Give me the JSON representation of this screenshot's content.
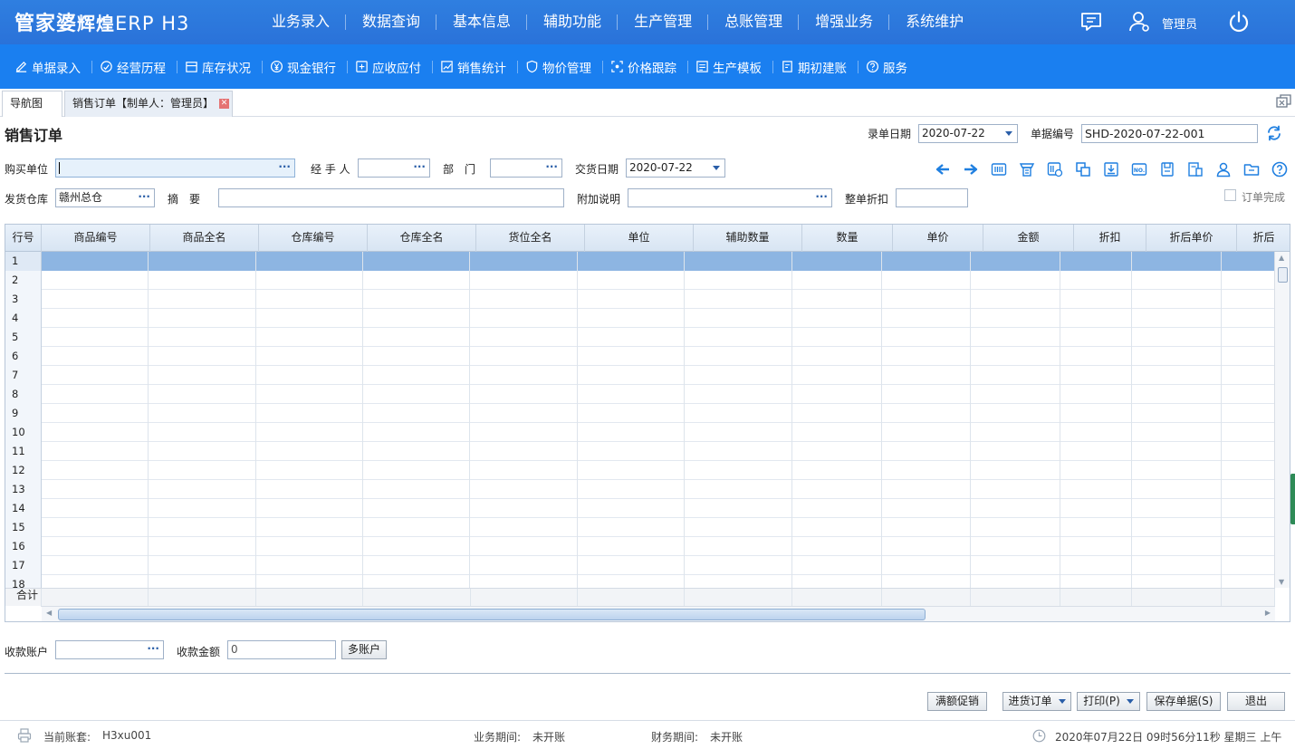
{
  "app": {
    "logo_main": "管家婆",
    "logo_sub": "辉煌",
    "logo_ver": "ERP H3"
  },
  "main_nav": [
    "业务录入",
    "数据查询",
    "基本信息",
    "辅助功能",
    "生产管理",
    "总账管理",
    "增强业务",
    "系统维护"
  ],
  "header_user": "管理员",
  "sub_nav": [
    {
      "label": "单据录入",
      "icon": "edit-icon"
    },
    {
      "label": "经营历程",
      "icon": "history-icon"
    },
    {
      "label": "库存状况",
      "icon": "warehouse-icon"
    },
    {
      "label": "现金银行",
      "icon": "yen-icon"
    },
    {
      "label": "应收应付",
      "icon": "ledger-icon"
    },
    {
      "label": "销售统计",
      "icon": "stats-icon"
    },
    {
      "label": "物价管理",
      "icon": "shield-icon"
    },
    {
      "label": "价格跟踪",
      "icon": "track-icon"
    },
    {
      "label": "生产模板",
      "icon": "template-icon"
    },
    {
      "label": "期初建账",
      "icon": "account-icon"
    },
    {
      "label": "服务",
      "icon": "help-icon"
    }
  ],
  "tabs": {
    "nav": "导航图",
    "active": "销售订单【制单人：管理员】"
  },
  "form": {
    "title": "销售订单",
    "entry_date_label": "录单日期",
    "entry_date": "2020-07-22",
    "doc_no_label": "单据编号",
    "doc_no": "SHD-2020-07-22-001",
    "buyer_label": "购买单位",
    "buyer": "",
    "handler_label": "经 手 人",
    "handler": "",
    "dept_label": "部　门",
    "dept": "",
    "delivery_date_label": "交货日期",
    "delivery_date": "2020-07-22",
    "warehouse_label": "发货仓库",
    "warehouse": "赣州总仓",
    "summary_label": "摘　要",
    "summary": "",
    "extra_label": "附加说明",
    "extra": "",
    "discount_label": "整单折扣",
    "discount": "",
    "order_done_label": "订单完成"
  },
  "toolbar_icons": [
    "arrow-left-icon",
    "arrow-right-icon",
    "barcode-icon",
    "print-template-icon",
    "scan-icon",
    "copy-icon",
    "import-icon",
    "number-icon",
    "save-icon",
    "stats-doc-icon",
    "person-icon",
    "folder-icon",
    "help-circle-icon"
  ],
  "grid": {
    "columns": [
      "行号",
      "商品编号",
      "商品全名",
      "仓库编号",
      "仓库全名",
      "货位全名",
      "单位",
      "辅助数量",
      "数量",
      "单价",
      "金额",
      "折扣",
      "折后单价",
      "折后"
    ],
    "rows": [
      "1",
      "2",
      "3",
      "4",
      "5",
      "6",
      "7",
      "8",
      "9",
      "10",
      "11",
      "12",
      "13",
      "14",
      "15",
      "16",
      "17",
      "18"
    ],
    "total_label": "合计"
  },
  "payment": {
    "account_label": "收款账户",
    "account": "",
    "amount_label": "收款金额",
    "amount": "0",
    "multi_button": "多账户"
  },
  "buttons": {
    "promo": "满额促销",
    "purchase_order": "进货订单",
    "print": "打印(P)",
    "save": "保存单据(S)",
    "exit": "退出"
  },
  "status": {
    "account_label": "当前账套:",
    "account": "H3xu001",
    "biz_period_label": "业务期间:",
    "biz_period": "未开账",
    "fin_period_label": "财务期间:",
    "fin_period": "未开账",
    "datetime": "2020年07月22日 09时56分11秒 星期三 上午"
  },
  "colors": {
    "topbar": "#2a72d9",
    "subbar": "#1a7ff0",
    "row_selected": "#8db5e2"
  }
}
